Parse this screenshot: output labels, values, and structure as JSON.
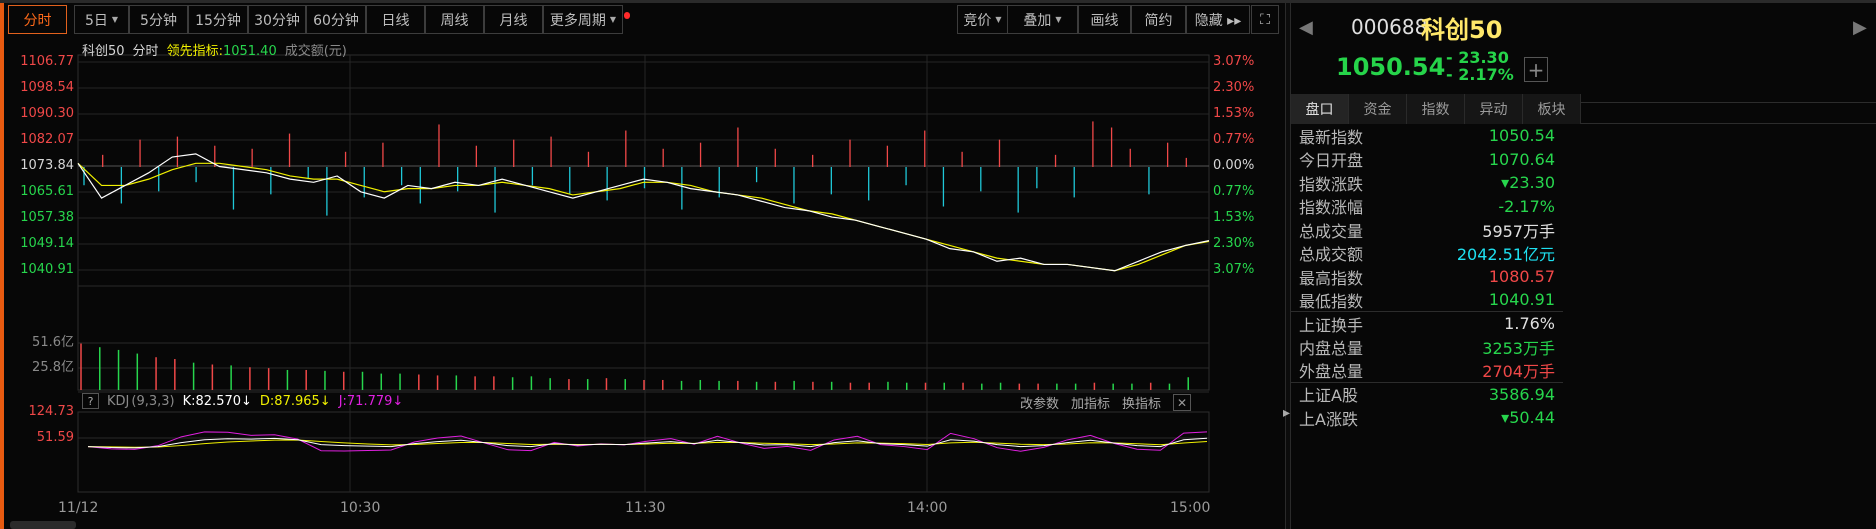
{
  "toolbar": {
    "periods": [
      {
        "label": "分时",
        "active": true
      },
      {
        "label": "5日",
        "caret": true
      },
      {
        "label": "5分钟"
      },
      {
        "label": "15分钟"
      },
      {
        "label": "30分钟"
      },
      {
        "label": "60分钟"
      },
      {
        "label": "日线"
      },
      {
        "label": "周线"
      },
      {
        "label": "月线"
      },
      {
        "label": "更多周期",
        "caret": true,
        "dot": true
      }
    ],
    "right": [
      {
        "label": "竞价",
        "caret": true
      },
      {
        "label": "叠加",
        "caret": true
      },
      {
        "label": "画线"
      },
      {
        "label": "简约"
      },
      {
        "label": "隐藏 ▸▸"
      }
    ],
    "fullscreen_icon": "expand-icon"
  },
  "legend": {
    "name": "科创50",
    "mode": "分时",
    "lead_label": "领先指标:",
    "lead_value": "1051.40",
    "amount_label": "成交额(元)"
  },
  "price_axis": {
    "left": [
      "1106.77",
      "1098.54",
      "1090.30",
      "1082.07",
      "1073.84",
      "1065.61",
      "1057.38",
      "1049.14",
      "1040.91"
    ],
    "right": [
      "3.07%",
      "2.30%",
      "1.53%",
      "0.77%",
      "0.00%",
      "0.77%",
      "1.53%",
      "2.30%",
      "3.07%"
    ]
  },
  "volume_axis": [
    "51.6亿",
    "25.8亿"
  ],
  "kdj": {
    "help": "?",
    "name": "KDJ",
    "params": "(9,3,3)",
    "k": "K:82.570↓",
    "d": "D:87.965↓",
    "j": "J:71.779↓",
    "axis": [
      "124.73",
      "51.59"
    ],
    "buttons": [
      "改参数",
      "加指标",
      "换指标"
    ],
    "close": "✕"
  },
  "time_axis": [
    "11/12",
    "10:30",
    "11:30",
    "14:00",
    "15:00"
  ],
  "colors": {
    "up": "#f04848",
    "down": "#27d64d",
    "lead_down": "#1fc8d8",
    "price_line": "#ffffff",
    "avg_line": "#f0f000",
    "k": "#ffffff",
    "d": "#f0f000",
    "j": "#e020e0"
  },
  "chart_data": {
    "type": "line",
    "price": [
      1075,
      1064,
      1068,
      1072,
      1077,
      1078,
      1074,
      1073,
      1072,
      1070,
      1069,
      1071,
      1066,
      1064,
      1068,
      1067,
      1069,
      1068,
      1070,
      1068,
      1066,
      1064,
      1066,
      1068,
      1070,
      1069,
      1067,
      1066,
      1065,
      1063,
      1061,
      1060,
      1058,
      1057,
      1055,
      1053,
      1051,
      1048,
      1047,
      1044,
      1045,
      1043,
      1043,
      1042,
      1041,
      1044,
      1047,
      1049,
      1050.54
    ],
    "avg": [
      1075,
      1068,
      1068,
      1070,
      1073,
      1075,
      1075,
      1074,
      1073,
      1071,
      1070,
      1070,
      1068,
      1066,
      1067,
      1067,
      1068,
      1068,
      1069,
      1068,
      1067,
      1065,
      1066,
      1067,
      1069,
      1069,
      1068,
      1066,
      1065,
      1064,
      1062,
      1060,
      1059,
      1057,
      1055,
      1053,
      1051,
      1049,
      1047,
      1045,
      1044,
      1043,
      1043,
      1042,
      1041,
      1043,
      1046,
      1049,
      1050.3
    ],
    "lead_bars": [
      -0.6,
      0.4,
      -1.2,
      0.9,
      -0.8,
      1.0,
      -0.5,
      0.7,
      -1.4,
      0.6,
      -0.9,
      1.1,
      -0.4,
      -1.6,
      0.5,
      -1.0,
      0.8,
      -0.6,
      -1.2,
      1.4,
      -0.8,
      0.7,
      -1.5,
      0.9,
      -0.6,
      1.0,
      -0.9,
      0.5,
      -1.1,
      1.2,
      -0.7,
      0.6,
      -1.4,
      0.8,
      -1.0,
      1.3,
      -0.5,
      0.6,
      -1.2,
      0.4,
      -0.9,
      0.9,
      -1.1,
      0.7,
      -0.6,
      1.2,
      -1.3,
      0.5,
      -0.8,
      0.9,
      -1.5,
      -0.7,
      0.4,
      -1.0,
      1.5,
      1.3,
      0.6,
      -0.9,
      0.8,
      0.3
    ],
    "volume": [
      51,
      47,
      44,
      40,
      36,
      34,
      30,
      28,
      27,
      25,
      24,
      22,
      22,
      21,
      20,
      20,
      18,
      18,
      17,
      16,
      16,
      15,
      15,
      14,
      15,
      13,
      12,
      12,
      13,
      12,
      11,
      11,
      10,
      11,
      10,
      10,
      9,
      9,
      10,
      9,
      9,
      8,
      8,
      9,
      8,
      8,
      8,
      8,
      7,
      8,
      7,
      7,
      7,
      7,
      8,
      7,
      7,
      8,
      7,
      14
    ],
    "volume_up": "rgggrrgrgrrgrgrgggrrgrrgggrgrgrrgggrgrgrgrrggrgrggrrggrggrg",
    "k": [
      40,
      35,
      33,
      40,
      60,
      75,
      80,
      78,
      82,
      75,
      50,
      45,
      42,
      40,
      55,
      65,
      72,
      60,
      45,
      40,
      55,
      48,
      52,
      50,
      58,
      65,
      55,
      72,
      60,
      48,
      50,
      40,
      60,
      70,
      55,
      50,
      42,
      75,
      68,
      50,
      40,
      45,
      60,
      72,
      58,
      45,
      40,
      75,
      82.57
    ]
  },
  "sidebar": {
    "code": "000688",
    "name": "科创50",
    "price": "1050.54",
    "change": "- 23.30",
    "change_pct": "- 2.17%",
    "add_icon": "plus-icon",
    "tabs": [
      "盘口",
      "资金",
      "指数",
      "异动",
      "板块"
    ],
    "rows": [
      {
        "k": "最新指数",
        "v": "1050.54",
        "c": "grn"
      },
      {
        "k": "今日开盘",
        "v": "1070.64",
        "c": "grn"
      },
      {
        "k": "指数涨跌",
        "v": "▾23.30",
        "c": "grn"
      },
      {
        "k": "指数涨幅",
        "v": "-2.17%",
        "c": "grn"
      },
      {
        "k": "总成交量",
        "v": "5957万手",
        "c": "wht"
      },
      {
        "k": "总成交额",
        "v": "2042.51亿元",
        "c": "cyan"
      },
      {
        "k": "最高指数",
        "v": "1080.57",
        "c": "red"
      },
      {
        "k": "最低指数",
        "v": "1040.91",
        "c": "grn",
        "sep": true
      },
      {
        "k": "上证换手",
        "v": "1.76%",
        "c": "wht"
      },
      {
        "k": "内盘总量",
        "v": "3253万手",
        "c": "grn"
      },
      {
        "k": "外盘总量",
        "v": "2704万手",
        "c": "red",
        "sep": true
      },
      {
        "k": "上证A股",
        "v": "3586.94",
        "c": "grn"
      },
      {
        "k": "上A涨跌",
        "v": "▾50.44",
        "c": "grn"
      }
    ]
  }
}
